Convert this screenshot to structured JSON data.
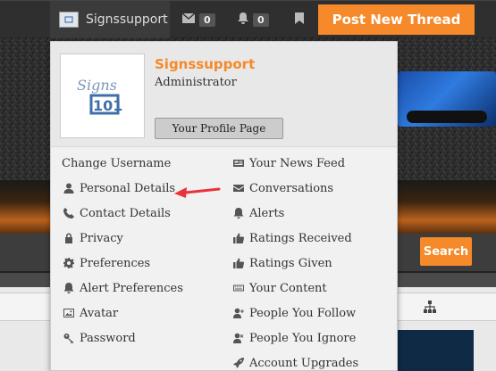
{
  "topbar": {
    "username": "Signssupport",
    "conversations_count": "0",
    "alerts_count": "0",
    "post_button": "Post New Thread"
  },
  "menu": {
    "username": "Signssupport",
    "role": "Administrator",
    "profile_button": "Your Profile Page",
    "left_items": [
      {
        "label": "Change Username",
        "icon": "none"
      },
      {
        "label": "Personal Details",
        "icon": "user-icon"
      },
      {
        "label": "Contact Details",
        "icon": "phone-icon"
      },
      {
        "label": "Privacy",
        "icon": "lock-icon"
      },
      {
        "label": "Preferences",
        "icon": "gear-icon"
      },
      {
        "label": "Alert Preferences",
        "icon": "bell-icon"
      },
      {
        "label": "Avatar",
        "icon": "image-icon"
      },
      {
        "label": "Password",
        "icon": "key-icon"
      }
    ],
    "right_items": [
      {
        "label": "Your News Feed",
        "icon": "newspaper-icon"
      },
      {
        "label": "Conversations",
        "icon": "envelope-icon"
      },
      {
        "label": "Alerts",
        "icon": "bell-icon"
      },
      {
        "label": "Ratings Received",
        "icon": "thumbs-up-icon"
      },
      {
        "label": "Ratings Given",
        "icon": "thumbs-up-icon"
      },
      {
        "label": "Your Content",
        "icon": "keyboard-icon"
      },
      {
        "label": "People You Follow",
        "icon": "user-plus-icon"
      },
      {
        "label": "People You Ignore",
        "icon": "user-times-icon"
      },
      {
        "label": "Account Upgrades",
        "icon": "rocket-icon"
      }
    ]
  },
  "page": {
    "search_button": "Search"
  },
  "colors": {
    "accent": "#f6892a",
    "annotation_arrow": "#e8333a",
    "topbar": "#2f2f2f"
  }
}
